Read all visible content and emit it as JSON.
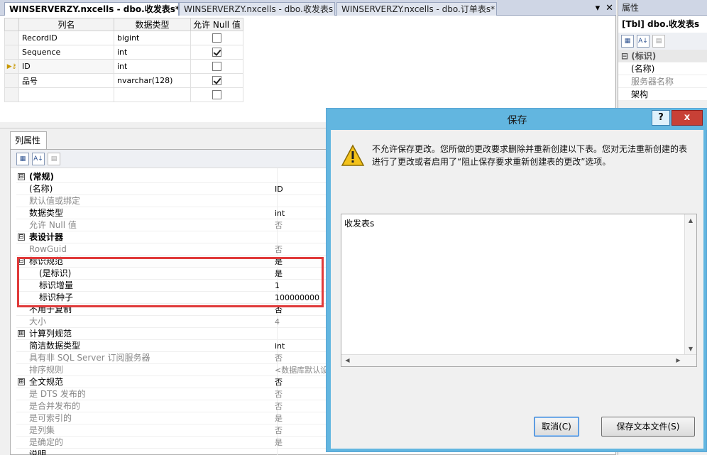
{
  "tabs": [
    {
      "label": "WINSERVERZY.nxcells - dbo.收发表s*",
      "active": true
    },
    {
      "label": "WINSERVERZY.nxcells - dbo.收发表s",
      "active": false
    },
    {
      "label": "WINSERVERZY.nxcells - dbo.订单表s*",
      "active": false
    }
  ],
  "tab_controls": {
    "dropdown": "▾",
    "close": "✕"
  },
  "grid": {
    "headers": [
      "列名",
      "数据类型",
      "允许 Null 值"
    ],
    "rows": [
      {
        "name": "RecordID",
        "type": "bigint",
        "nullable": false
      },
      {
        "name": "Sequence",
        "type": "int",
        "nullable": true
      },
      {
        "name": "ID",
        "type": "int",
        "nullable": false,
        "current": true,
        "key": true
      },
      {
        "name": "品号",
        "type": "nvarchar(128)",
        "nullable": true
      },
      {
        "name": "",
        "type": "",
        "nullable": false
      }
    ]
  },
  "properties_panel": {
    "title": "属性",
    "object": "[Tbl] dbo.收发表s",
    "rows": [
      {
        "kind": "cat",
        "label": "(标识)"
      },
      {
        "kind": "item",
        "label": "(名称)"
      },
      {
        "kind": "item grey",
        "label": "服务器名称"
      },
      {
        "kind": "item",
        "label": "架构"
      }
    ]
  },
  "column_properties": {
    "tab": "列属性",
    "rows": [
      {
        "style": "cat",
        "exp": "⊟",
        "key": "(常规)",
        "value": ""
      },
      {
        "style": "",
        "key": "(名称)",
        "value": "ID"
      },
      {
        "style": "grey",
        "key": "默认值或绑定",
        "value": ""
      },
      {
        "style": "",
        "key": "数据类型",
        "value": "int"
      },
      {
        "style": "grey",
        "key": "允许 Null 值",
        "value": "否"
      },
      {
        "style": "cat",
        "exp": "⊟",
        "key": "表设计器",
        "value": ""
      },
      {
        "style": "grey",
        "key": "RowGuid",
        "value": "否"
      },
      {
        "style": "hl",
        "exp": "⊟",
        "key": "标识规范",
        "value": "是"
      },
      {
        "style": "sub",
        "key": "(是标识)",
        "value": "是"
      },
      {
        "style": "sub",
        "key": "标识增量",
        "value": "1"
      },
      {
        "style": "sub",
        "key": "标识种子",
        "value": "100000000"
      },
      {
        "style": "",
        "key": "不用于复制",
        "value": "否"
      },
      {
        "style": "grey",
        "key": "大小",
        "value": "4"
      },
      {
        "style": "",
        "exp": "⊞",
        "key": "计算列规范",
        "value": ""
      },
      {
        "style": "",
        "key": "简洁数据类型",
        "value": "int"
      },
      {
        "style": "grey",
        "key": "具有非 SQL Server 订阅服务器",
        "value": "否"
      },
      {
        "style": "grey",
        "key": "排序规则",
        "value": "<数据库默认设"
      },
      {
        "style": "",
        "exp": "⊞",
        "key": "全文规范",
        "value": "否"
      },
      {
        "style": "grey",
        "key": "是 DTS 发布的",
        "value": "否"
      },
      {
        "style": "grey",
        "key": "是合并发布的",
        "value": "否"
      },
      {
        "style": "grey",
        "key": "是可索引的",
        "value": "是"
      },
      {
        "style": "grey",
        "key": "是列集",
        "value": "否"
      },
      {
        "style": "grey",
        "key": "是确定的",
        "value": "是"
      },
      {
        "style": "",
        "key": "说明",
        "value": ""
      }
    ]
  },
  "dialog": {
    "title": "保存",
    "help": "?",
    "close": "x",
    "message": "不允许保存更改。您所做的更改要求删除并重新创建以下表。您对无法重新创建的表进行了更改或者启用了“阻止保存要求重新创建表的更改”选项。",
    "table_list": "收发表s",
    "cancel_label": "取消(C)",
    "save_text_label": "保存文本文件(S)"
  },
  "colors": {
    "highlight": "#e03a3a",
    "titlebar": "#62b6e0",
    "close": "#c84036"
  }
}
